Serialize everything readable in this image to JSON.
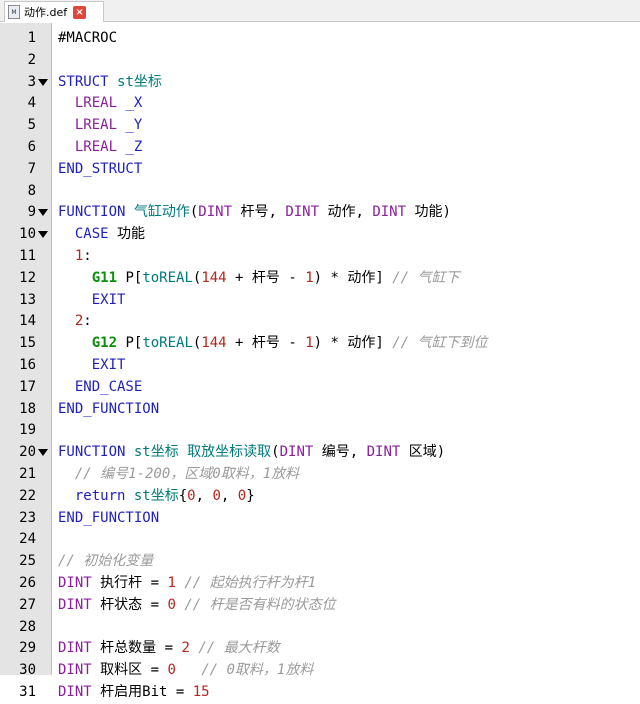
{
  "tab": {
    "title": "动作.def",
    "file_icon_label": "M"
  },
  "editor": {
    "lines": [
      {
        "n": "1",
        "fold": false,
        "tokens": [
          [
            "#MACROC",
            ""
          ]
        ]
      },
      {
        "n": "2",
        "fold": false,
        "tokens": []
      },
      {
        "n": "3",
        "fold": true,
        "tokens": [
          [
            "STRUCT ",
            "kw"
          ],
          [
            "st坐标",
            "id"
          ]
        ]
      },
      {
        "n": "4",
        "fold": false,
        "tokens": [
          [
            "  ",
            ""
          ],
          [
            "LREAL ",
            "ty"
          ],
          [
            "_X",
            "kw"
          ]
        ]
      },
      {
        "n": "5",
        "fold": false,
        "tokens": [
          [
            "  ",
            ""
          ],
          [
            "LREAL ",
            "ty"
          ],
          [
            "_Y",
            "kw"
          ]
        ]
      },
      {
        "n": "6",
        "fold": false,
        "tokens": [
          [
            "  ",
            ""
          ],
          [
            "LREAL ",
            "ty"
          ],
          [
            "_Z",
            "kw"
          ]
        ]
      },
      {
        "n": "7",
        "fold": false,
        "tokens": [
          [
            "END_STRUCT",
            "kw"
          ]
        ]
      },
      {
        "n": "8",
        "fold": false,
        "tokens": []
      },
      {
        "n": "9",
        "fold": true,
        "tokens": [
          [
            "FUNCTION ",
            "kw"
          ],
          [
            "气缸动作",
            "id"
          ],
          [
            "(",
            ""
          ],
          [
            "DINT ",
            "ty"
          ],
          [
            "杆号, ",
            ""
          ],
          [
            "DINT ",
            "ty"
          ],
          [
            "动作, ",
            ""
          ],
          [
            "DINT ",
            "ty"
          ],
          [
            "功能)",
            ""
          ]
        ]
      },
      {
        "n": "10",
        "fold": true,
        "tokens": [
          [
            "  ",
            ""
          ],
          [
            "CASE ",
            "kw"
          ],
          [
            "功能",
            ""
          ]
        ]
      },
      {
        "n": "11",
        "fold": false,
        "tokens": [
          [
            "  ",
            ""
          ],
          [
            "1",
            "num"
          ],
          [
            ":",
            ""
          ]
        ]
      },
      {
        "n": "12",
        "fold": false,
        "tokens": [
          [
            "    ",
            ""
          ],
          [
            "G11",
            "bold"
          ],
          [
            " P[",
            ""
          ],
          [
            "toREAL",
            "id"
          ],
          [
            "(",
            ""
          ],
          [
            "144",
            "num"
          ],
          [
            " + 杆号 - ",
            ""
          ],
          [
            "1",
            "num"
          ],
          [
            ") * 动作] ",
            ""
          ],
          [
            "// 气缸下",
            "cm"
          ]
        ]
      },
      {
        "n": "13",
        "fold": false,
        "tokens": [
          [
            "    ",
            ""
          ],
          [
            "EXIT",
            "kw"
          ]
        ]
      },
      {
        "n": "14",
        "fold": false,
        "tokens": [
          [
            "  ",
            ""
          ],
          [
            "2",
            "num"
          ],
          [
            ":",
            ""
          ]
        ]
      },
      {
        "n": "15",
        "fold": false,
        "tokens": [
          [
            "    ",
            ""
          ],
          [
            "G12",
            "bold"
          ],
          [
            " P[",
            ""
          ],
          [
            "toREAL",
            "id"
          ],
          [
            "(",
            ""
          ],
          [
            "144",
            "num"
          ],
          [
            " + 杆号 - ",
            ""
          ],
          [
            "1",
            "num"
          ],
          [
            ") * 动作] ",
            ""
          ],
          [
            "// 气缸下到位",
            "cm"
          ]
        ]
      },
      {
        "n": "16",
        "fold": false,
        "tokens": [
          [
            "    ",
            ""
          ],
          [
            "EXIT",
            "kw"
          ]
        ]
      },
      {
        "n": "17",
        "fold": false,
        "tokens": [
          [
            "  ",
            ""
          ],
          [
            "END_CASE",
            "kw"
          ]
        ]
      },
      {
        "n": "18",
        "fold": false,
        "tokens": [
          [
            "END_FUNCTION",
            "kw"
          ]
        ]
      },
      {
        "n": "19",
        "fold": false,
        "tokens": []
      },
      {
        "n": "20",
        "fold": true,
        "tokens": [
          [
            "FUNCTION ",
            "kw"
          ],
          [
            "st坐标 ",
            "id"
          ],
          [
            "取放坐标读取",
            "id"
          ],
          [
            "(",
            ""
          ],
          [
            "DINT ",
            "ty"
          ],
          [
            "编号, ",
            ""
          ],
          [
            "DINT ",
            "ty"
          ],
          [
            "区域)",
            ""
          ]
        ]
      },
      {
        "n": "21",
        "fold": false,
        "tokens": [
          [
            "  ",
            ""
          ],
          [
            "// 编号1-200，区域0取料，1放料",
            "cm"
          ]
        ]
      },
      {
        "n": "22",
        "fold": false,
        "tokens": [
          [
            "  ",
            ""
          ],
          [
            "return ",
            "kw"
          ],
          [
            "st坐标",
            "id"
          ],
          [
            "{",
            ""
          ],
          [
            "0",
            "num"
          ],
          [
            ", ",
            ""
          ],
          [
            "0",
            "num"
          ],
          [
            ", ",
            ""
          ],
          [
            "0",
            "num"
          ],
          [
            "}",
            ""
          ]
        ]
      },
      {
        "n": "23",
        "fold": false,
        "tokens": [
          [
            "END_FUNCTION",
            "kw"
          ]
        ]
      },
      {
        "n": "24",
        "fold": false,
        "tokens": []
      },
      {
        "n": "25",
        "fold": false,
        "tokens": [
          [
            "// 初始化变量",
            "cm"
          ]
        ]
      },
      {
        "n": "26",
        "fold": false,
        "tokens": [
          [
            "DINT ",
            "ty"
          ],
          [
            "执行杆 = ",
            ""
          ],
          [
            "1",
            "num"
          ],
          [
            " ",
            ""
          ],
          [
            "// 起始执行杆为杆1",
            "cm"
          ]
        ]
      },
      {
        "n": "27",
        "fold": false,
        "tokens": [
          [
            "DINT ",
            "ty"
          ],
          [
            "杆状态 = ",
            ""
          ],
          [
            "0",
            "num"
          ],
          [
            " ",
            ""
          ],
          [
            "// 杆是否有料的状态位",
            "cm"
          ]
        ]
      },
      {
        "n": "28",
        "fold": false,
        "tokens": []
      },
      {
        "n": "29",
        "fold": false,
        "tokens": [
          [
            "DINT ",
            "ty"
          ],
          [
            "杆总数量 = ",
            ""
          ],
          [
            "2",
            "num"
          ],
          [
            " ",
            ""
          ],
          [
            "// 最大杆数",
            "cm"
          ]
        ]
      },
      {
        "n": "30",
        "fold": false,
        "tokens": [
          [
            "DINT ",
            "ty"
          ],
          [
            "取料区 = ",
            ""
          ],
          [
            "0",
            "num"
          ],
          [
            "   ",
            ""
          ],
          [
            "// 0取料，1放料",
            "cm"
          ]
        ]
      },
      {
        "n": "31",
        "fold": false,
        "tokens": [
          [
            "DINT ",
            "ty"
          ],
          [
            "杆启用Bit = ",
            ""
          ],
          [
            "15",
            "num"
          ]
        ]
      }
    ]
  }
}
